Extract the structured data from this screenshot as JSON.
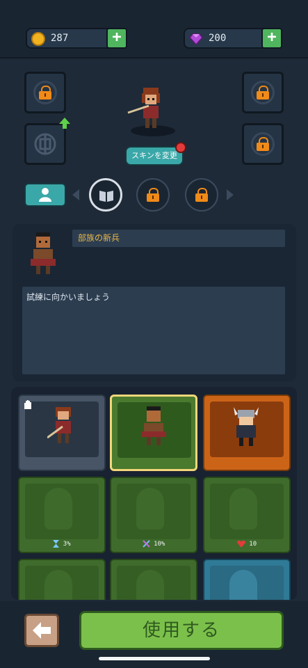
{
  "currency": {
    "coins": {
      "value": "287",
      "icon": "coin-icon",
      "color": "#f2b320"
    },
    "gems": {
      "value": "200",
      "icon": "gem-icon",
      "color": "#b04ad8"
    },
    "add_label": "+"
  },
  "hero_preview": {
    "skin_button_label": "スキンを変更",
    "notification": true
  },
  "equipment_slots": [
    {
      "side": "left",
      "state": "locked",
      "icon": "lock-icon"
    },
    {
      "side": "left",
      "state": "upgradeable",
      "icon": "emblem-icon",
      "badge": "up-arrow-icon"
    },
    {
      "side": "right",
      "state": "locked",
      "icon": "lock-icon"
    },
    {
      "side": "right",
      "state": "locked",
      "icon": "lock-icon"
    }
  ],
  "category_tabs": [
    {
      "icon": "person-icon",
      "active": true
    },
    {
      "icon": "book-icon",
      "selected": true
    },
    {
      "icon": "lock-icon",
      "locked": true
    },
    {
      "icon": "lock-icon",
      "locked": true
    }
  ],
  "selected_character": {
    "name": "部族の新兵",
    "description": "試練に向かいましょう"
  },
  "characters": [
    {
      "state": "owned",
      "label": "",
      "badge": "glove-icon"
    },
    {
      "state": "selected",
      "label": ""
    },
    {
      "state": "rare",
      "label": ""
    },
    {
      "state": "locked",
      "label": "3%",
      "icon": "hourglass-icon"
    },
    {
      "state": "locked",
      "label": "10%",
      "icon": "scroll-icon"
    },
    {
      "state": "locked",
      "label": "10",
      "icon": "heart-icon"
    },
    {
      "state": "locked",
      "label": ""
    },
    {
      "state": "locked",
      "label": ""
    },
    {
      "state": "lockedblue",
      "label": ""
    }
  ],
  "actions": {
    "back_icon": "arrow-left-icon",
    "use_label": "使用する"
  },
  "colors": {
    "accent_teal": "#3aa7a8",
    "confirm_green": "#7cc04c",
    "highlight_gold": "#f3d77a",
    "lock_orange": "#f08a18"
  }
}
